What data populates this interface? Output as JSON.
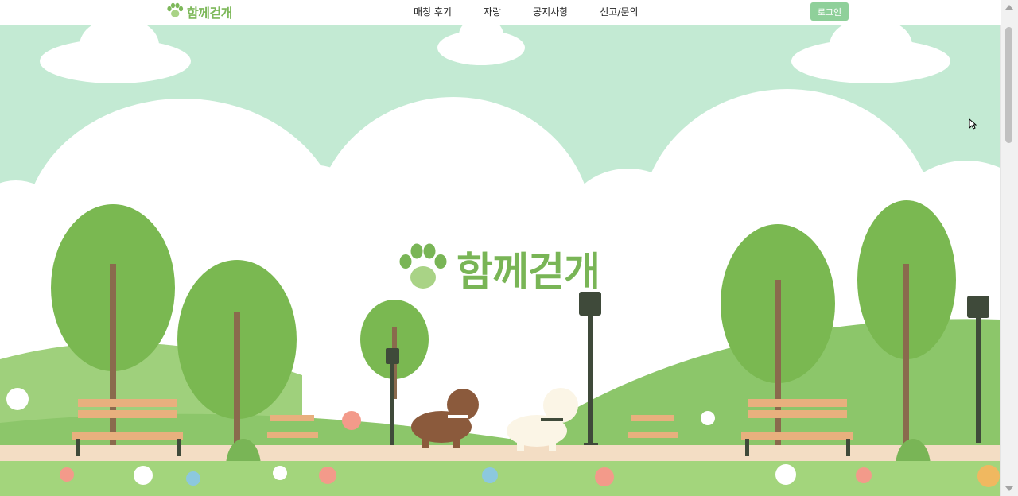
{
  "brand": {
    "name": "함께걷개",
    "color": "#7db85a",
    "icon": "paw-icon"
  },
  "nav": {
    "items": [
      {
        "label": "매칭 후기"
      },
      {
        "label": "자랑"
      },
      {
        "label": "공지사항"
      },
      {
        "label": "신고/문의"
      }
    ],
    "login_label": "로그인"
  },
  "hero": {
    "title": "함께걷개",
    "illustration": "park-with-two-dogs-walking",
    "colors": {
      "sky": "#c3ead3",
      "cloud": "#ffffff",
      "hill": "#8cc66a",
      "tree": "#7ab851",
      "path": "#f3ddc4"
    }
  }
}
